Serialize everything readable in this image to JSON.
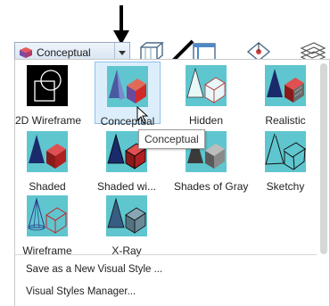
{
  "dropdown": {
    "selected": "Conceptual"
  },
  "styles": [
    {
      "label": "2D Wireframe"
    },
    {
      "label": "Conceptual"
    },
    {
      "label": "Hidden"
    },
    {
      "label": "Realistic"
    },
    {
      "label": "Shaded"
    },
    {
      "label": "Shaded wi..."
    },
    {
      "label": "Shades of Gray"
    },
    {
      "label": "Sketchy"
    },
    {
      "label": "Wireframe"
    },
    {
      "label": "X-Ray"
    }
  ],
  "tooltip": "Conceptual",
  "menu": {
    "save": "Save as a New Visual Style ...",
    "manager": "Visual Styles Manager..."
  },
  "colors": {
    "thumb_bg": "#5fc6cf",
    "selected_bg": "#dceefb",
    "accent": "#e03030"
  }
}
